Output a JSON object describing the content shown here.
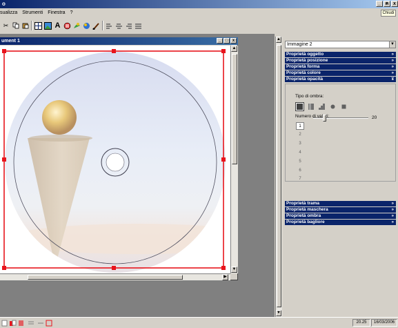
{
  "window": {
    "title_fragment": "o",
    "buttons": [
      "_",
      "ฅ",
      "x"
    ]
  },
  "menu": {
    "items": [
      "sualizza",
      "Strumenti",
      "Finestra",
      "?"
    ],
    "close_all_label": "Chiudi"
  },
  "document": {
    "title": "ument 1",
    "buttons": [
      "_",
      "□",
      "x"
    ],
    "art": {
      "colors": {
        "disc_edge": "#c8cfe4",
        "sky_top": "#dfe3f2",
        "sky_mid": "#e6ecf6",
        "horizon": "#efe5df",
        "selection": "#e8141c",
        "cone": "#d8c9b6"
      }
    }
  },
  "panel": {
    "object_selector": "Immagine 2",
    "sections_top": [
      "Proprietà oggetto",
      "Proprietà posizione",
      "Proprietà forma",
      "Proprietà colore",
      "Proprietà opacità"
    ],
    "open_section_chevron": "»",
    "opacity": {
      "shadow_type_label": "Tipo di ombra:",
      "shadow_types": [
        "solid-square-icon",
        "vertical-gradient-icon",
        "stepped-gradient-icon",
        "radial-dot-icon",
        "square-dot-icon"
      ],
      "values_label": "Numero di valori:",
      "values": [
        "1",
        "2",
        "3",
        "4",
        "5",
        "6",
        "7"
      ],
      "selected_value": "1",
      "slider_value": "20",
      "slider_fraction": 0.2
    },
    "sections_bottom": [
      "Proprietà trama",
      "Proprietà maschera",
      "Proprietà ombra",
      "Proprietà bagliore"
    ]
  },
  "status": {
    "time": "20.25",
    "date": "16/03/2006"
  },
  "colors": {
    "titlebar": "#0a246a",
    "section_header": "#0a246a",
    "chrome": "#d4d0c8",
    "mdi_bg": "#808080"
  }
}
